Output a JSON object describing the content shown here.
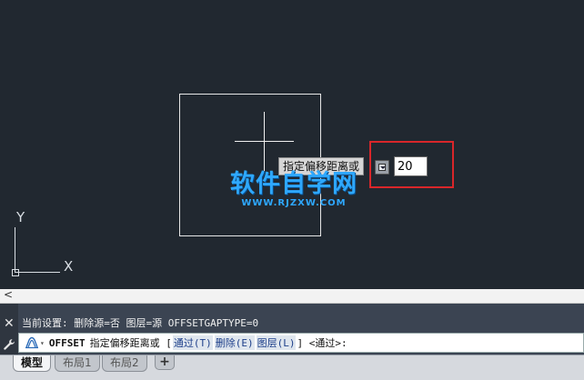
{
  "canvas": {
    "axis_y_label": "Y",
    "axis_x_label": "X",
    "tooltip_prompt": "指定偏移距离或",
    "distance_value": "20",
    "watermark_cn": "软件自学网",
    "watermark_en": "WWW.RJZXW.COM"
  },
  "command": {
    "collapse_icon": "chevron-left-icon",
    "history_line": "当前设置: 删除源=否  图层=源  OFFSETGAPTYPE=0",
    "command_name": "OFFSET",
    "prompt_text": "指定偏移距离或",
    "bracket_open": "[",
    "options": [
      {
        "label": "通过(T)"
      },
      {
        "label": "删除(E)"
      },
      {
        "label": "图层(L)"
      }
    ],
    "bracket_close": "]",
    "default_text": "<通过>:"
  },
  "tabs": [
    {
      "label": "模型",
      "active": true
    },
    {
      "label": "布局1",
      "active": false
    },
    {
      "label": "布局2",
      "active": false
    }
  ],
  "add_tab_label": "+",
  "colors": {
    "canvas_bg": "#212830",
    "highlight": "#d9262a",
    "watermark": "#2ea8ff"
  }
}
